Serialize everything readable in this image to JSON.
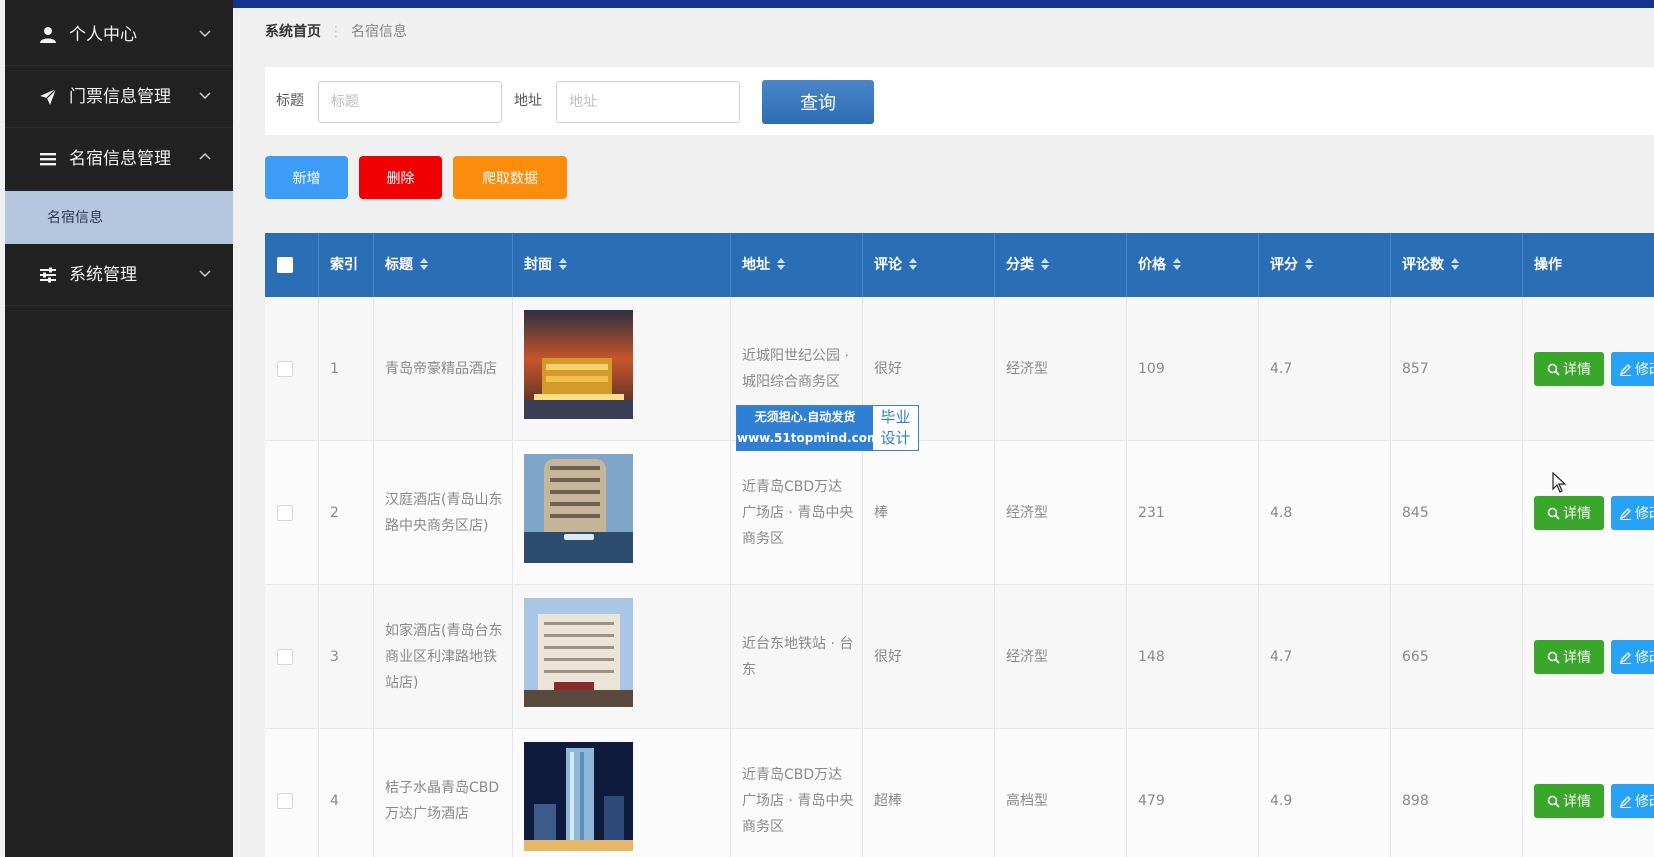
{
  "sidebar": {
    "items": [
      {
        "label": "个人中心",
        "icon": "user-icon",
        "expanded": false
      },
      {
        "label": "门票信息管理",
        "icon": "send-icon",
        "expanded": false
      },
      {
        "label": "名宿信息管理",
        "icon": "list-icon",
        "expanded": true
      },
      {
        "label": "系统管理",
        "icon": "sliders-icon",
        "expanded": false
      }
    ],
    "subitem": "名宿信息"
  },
  "breadcrumb": {
    "home": "系统首页",
    "current": "名宿信息"
  },
  "search": {
    "title_label": "标题",
    "title_placeholder": "标题",
    "address_label": "地址",
    "address_placeholder": "地址",
    "button": "查询"
  },
  "actions": {
    "add": "新增",
    "delete": "删除",
    "crawl": "爬取数据"
  },
  "table": {
    "columns": [
      "索引",
      "标题",
      "封面",
      "地址",
      "评论",
      "分类",
      "价格",
      "评分",
      "评论数",
      "操作"
    ],
    "rows": [
      {
        "index": "1",
        "title": "青岛帝豪精品酒店",
        "address": "近城阳世纪公园 · 城阳综合商务区",
        "comment": "很好",
        "category": "经济型",
        "price": "109",
        "score": "4.7",
        "reviews": "857"
      },
      {
        "index": "2",
        "title": "汉庭酒店(青岛山东路中央商务区店)",
        "address": "近青岛CBD万达广场店 · 青岛中央商务区",
        "comment": "棒",
        "category": "经济型",
        "price": "231",
        "score": "4.8",
        "reviews": "845"
      },
      {
        "index": "3",
        "title": "如家酒店(青岛台东商业区利津路地铁站店)",
        "address": "近台东地铁站 · 台东",
        "comment": "很好",
        "category": "经济型",
        "price": "148",
        "score": "4.7",
        "reviews": "665"
      },
      {
        "index": "4",
        "title": "桔子水晶青岛CBD万达广场酒店",
        "address": "近青岛CBD万达广场店 · 青岛中央商务区",
        "comment": "超棒",
        "category": "高档型",
        "price": "479",
        "score": "4.9",
        "reviews": "898"
      }
    ],
    "detail_button": "详情",
    "edit_button": "修改"
  },
  "watermark": {
    "line1": "无须担心.自动发货",
    "line2": "www.51topmind.com",
    "badge_line1": "毕业",
    "badge_line2": "设计"
  },
  "colors": {
    "sidebar_bg": "#222222",
    "topbar": "#13338e",
    "table_header": "#2a6fb6",
    "add": "#3d9cf5",
    "delete": "#f00000",
    "crawl": "#fb8c0c",
    "detail": "#3aa62c",
    "edit": "#26a3f2"
  }
}
